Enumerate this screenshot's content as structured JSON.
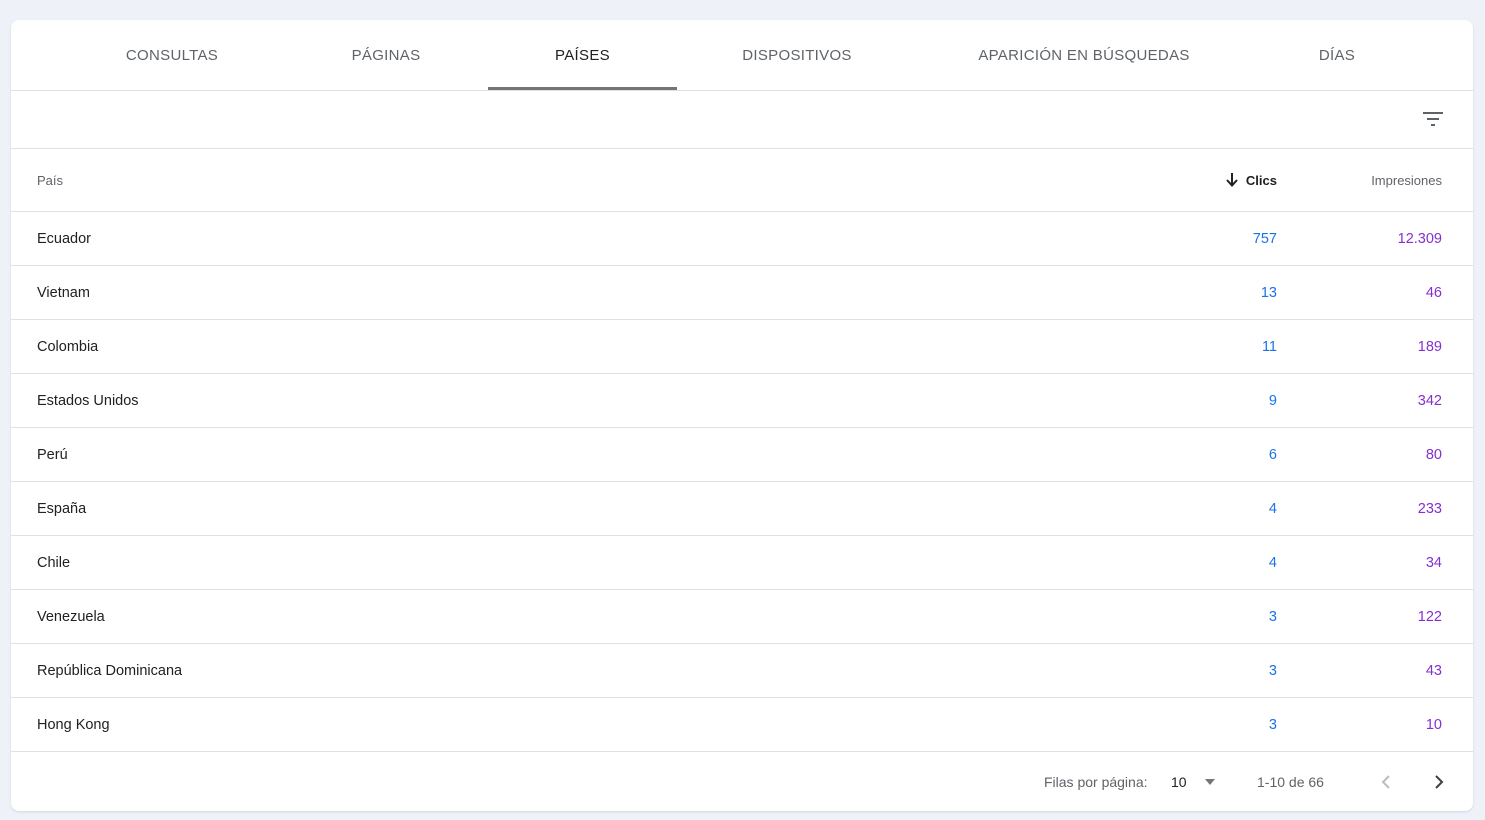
{
  "tabs": [
    {
      "label": "CONSULTAS"
    },
    {
      "label": "PÁGINAS"
    },
    {
      "label": "PAÍSES"
    },
    {
      "label": "DISPOSITIVOS"
    },
    {
      "label": "APARICIÓN EN BÚSQUEDAS"
    },
    {
      "label": "DÍAS"
    }
  ],
  "toolbar": {
    "filter_icon": "filter-list-icon"
  },
  "table": {
    "headers": {
      "country": "País",
      "clicks": "Clics",
      "impressions": "Impresiones"
    },
    "sort_icon": "arrow-downward-icon",
    "rows": [
      {
        "country": "Ecuador",
        "clicks": "757",
        "impressions": "12.309"
      },
      {
        "country": "Vietnam",
        "clicks": "13",
        "impressions": "46"
      },
      {
        "country": "Colombia",
        "clicks": "11",
        "impressions": "189"
      },
      {
        "country": "Estados Unidos",
        "clicks": "9",
        "impressions": "342"
      },
      {
        "country": "Perú",
        "clicks": "6",
        "impressions": "80"
      },
      {
        "country": "España",
        "clicks": "4",
        "impressions": "233"
      },
      {
        "country": "Chile",
        "clicks": "4",
        "impressions": "34"
      },
      {
        "country": "Venezuela",
        "clicks": "3",
        "impressions": "122"
      },
      {
        "country": "República Dominicana",
        "clicks": "3",
        "impressions": "43"
      },
      {
        "country": "Hong Kong",
        "clicks": "3",
        "impressions": "10"
      }
    ]
  },
  "pagination": {
    "rows_per_page_label": "Filas por página:",
    "rows_per_page_value": "10",
    "range": "1-10 de 66"
  },
  "colors": {
    "clicks": "#1a73e8",
    "impressions": "#8430ce",
    "tab_indicator": "#757575"
  }
}
